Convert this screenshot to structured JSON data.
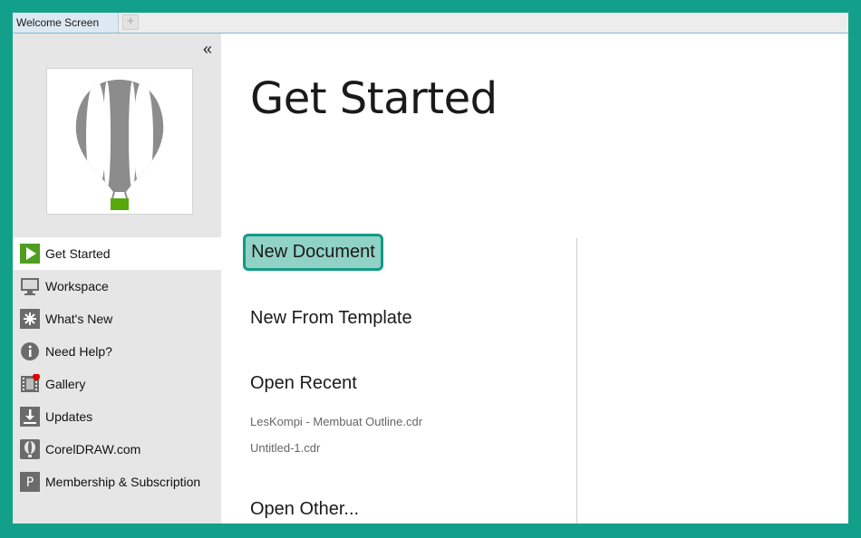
{
  "tabs": [
    {
      "label": "Welcome Screen",
      "active": true
    }
  ],
  "tab_add_icon": "plus-icon",
  "sidebar": {
    "collapse_icon": "double-chevron-left-icon",
    "items": [
      {
        "label": "Get Started",
        "icon": "play-icon",
        "active": true
      },
      {
        "label": "Workspace",
        "icon": "monitor-icon"
      },
      {
        "label": "What's New",
        "icon": "star-burst-icon"
      },
      {
        "label": "Need Help?",
        "icon": "info-icon"
      },
      {
        "label": "Gallery",
        "icon": "film-icon",
        "badge": true
      },
      {
        "label": "Updates",
        "icon": "download-icon"
      },
      {
        "label": "CorelDRAW.com",
        "icon": "balloon-icon"
      },
      {
        "label": "Membership & Subscription",
        "icon": "letter-p-icon"
      }
    ]
  },
  "main": {
    "title": "Get Started",
    "actions": {
      "new_document": "New Document",
      "new_from_template": "New From Template",
      "open_recent": "Open Recent",
      "open_other": "Open Other..."
    },
    "recent_files": [
      "LesKompi - Membuat Outline.cdr",
      "Untitled-1.cdr"
    ]
  },
  "colors": {
    "frame": "#13a08a",
    "highlight_fill": "#91d2c6",
    "highlight_border": "#139a86",
    "logo_gray": "#8c8c8c",
    "logo_green": "#57a80a",
    "play_green": "#4f9e1f",
    "badge_red": "#e00000"
  }
}
